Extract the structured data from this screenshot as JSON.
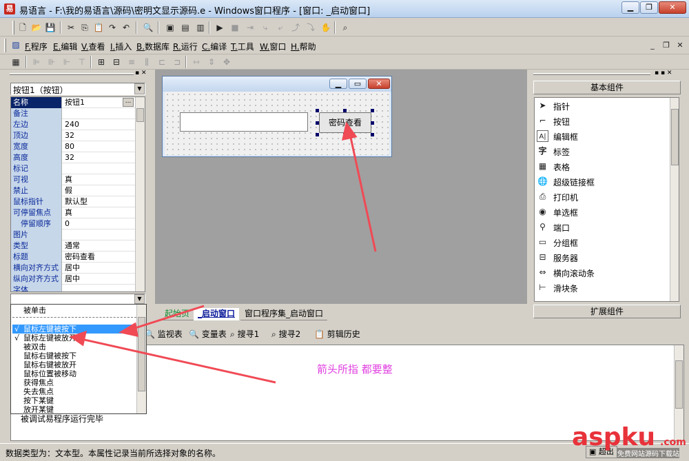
{
  "window": {
    "title": "易语言 - F:\\我的易语言\\源码\\密明文显示源码.e - Windows窗口程序 - [窗口: _启动窗口]",
    "minimize_glyph": "▁",
    "restore_glyph": "❐",
    "close_glyph": "✕"
  },
  "menu": {
    "items": [
      {
        "key": "F.",
        "label": "程序"
      },
      {
        "key": "E.",
        "label": "编辑"
      },
      {
        "key": "V.",
        "label": "查看"
      },
      {
        "key": "I.",
        "label": "插入"
      },
      {
        "key": "B.",
        "label": "数据库"
      },
      {
        "key": "R.",
        "label": "运行"
      },
      {
        "key": "C.",
        "label": "编译"
      },
      {
        "key": "T.",
        "label": "工具"
      },
      {
        "key": "W.",
        "label": "窗口"
      },
      {
        "key": "H.",
        "label": "帮助"
      }
    ]
  },
  "properties": {
    "object_selector": "按钮1（按钮）",
    "rows": [
      {
        "name": "名称",
        "value": "按钮1"
      },
      {
        "name": "备注",
        "value": ""
      },
      {
        "name": "左边",
        "value": "240"
      },
      {
        "name": "顶边",
        "value": "32"
      },
      {
        "name": "宽度",
        "value": "80"
      },
      {
        "name": "高度",
        "value": "32"
      },
      {
        "name": "标记",
        "value": ""
      },
      {
        "name": "可视",
        "value": "真"
      },
      {
        "name": "禁止",
        "value": "假"
      },
      {
        "name": "鼠标指针",
        "value": "默认型"
      },
      {
        "name": "可停留焦点",
        "value": "真"
      },
      {
        "name": "停留顺序",
        "value": "0"
      },
      {
        "name": "图片",
        "value": ""
      },
      {
        "name": "类型",
        "value": "通常"
      },
      {
        "name": "标题",
        "value": "密码查看"
      },
      {
        "name": "横向对齐方式",
        "value": "居中"
      },
      {
        "name": "纵向对齐方式",
        "value": "居中"
      },
      {
        "name": "字体",
        "value": ""
      }
    ],
    "ellipsis": "..."
  },
  "designer": {
    "button_caption": "密码查看",
    "tabs": [
      "起始页",
      "_启动窗口",
      "窗口程序集_启动窗口"
    ]
  },
  "components": {
    "header": "基本组件",
    "footer": "扩展组件",
    "items": [
      {
        "icon": "pointer-icon",
        "glyph": "➤",
        "label": "指针"
      },
      {
        "icon": "button-icon",
        "glyph": "⌐",
        "label": "按钮"
      },
      {
        "icon": "editbox-icon",
        "glyph": "A|",
        "label": "编辑框"
      },
      {
        "icon": "label-icon",
        "glyph": "字",
        "label": "标签"
      },
      {
        "icon": "table-icon",
        "glyph": "▦",
        "label": "表格"
      },
      {
        "icon": "hyperlink-icon",
        "glyph": "🌐",
        "label": "超级链接框"
      },
      {
        "icon": "printer-icon",
        "glyph": "⎙",
        "label": "打印机"
      },
      {
        "icon": "radio-icon",
        "glyph": "◉",
        "label": "单选框"
      },
      {
        "icon": "port-icon",
        "glyph": "⚲",
        "label": "端口"
      },
      {
        "icon": "groupbox-icon",
        "glyph": "▭",
        "label": "分组框"
      },
      {
        "icon": "server-icon",
        "glyph": "⊟",
        "label": "服务器"
      },
      {
        "icon": "hscroll-icon",
        "glyph": "⇔",
        "label": "横向滚动条"
      },
      {
        "icon": "slider-icon",
        "glyph": "⊢",
        "label": "滑块条"
      }
    ]
  },
  "event_selector": {
    "items": [
      {
        "label": "被单击",
        "check": ""
      },
      {
        "label": "鼠标左键被按下",
        "check": "√"
      },
      {
        "label": "鼠标左键被放开",
        "check": "√"
      },
      {
        "label": "被双击",
        "check": ""
      },
      {
        "label": "鼠标右键被按下",
        "check": ""
      },
      {
        "label": "鼠标右键被放开",
        "check": ""
      },
      {
        "label": "鼠标位置被移动",
        "check": ""
      },
      {
        "label": "获得焦点",
        "check": ""
      },
      {
        "label": "失去焦点",
        "check": ""
      },
      {
        "label": "按下某键",
        "check": ""
      },
      {
        "label": "放开某键",
        "check": ""
      }
    ],
    "selected_index": 1
  },
  "bottom_tabs": [
    "监视表",
    "变量表",
    "搜寻1",
    "搜寻2",
    "剪辑历史"
  ],
  "output": {
    "lines": [
      "被调试易程序运行完毕"
    ],
    "annotation": "箭头所指 都要整",
    "annotation_color": "#e040e0"
  },
  "status": {
    "text": "数据类型为：文本型。本属性记录当前所选择对象的名称。",
    "right_button": "超出"
  },
  "watermark": {
    "brand": "aspku",
    "suffix": ".com",
    "tagline": "免费网站源码下载站"
  },
  "colors": {
    "selection": "#0a246a",
    "dropdown_selection": "#3399ff",
    "arrow": "#f04a55"
  }
}
